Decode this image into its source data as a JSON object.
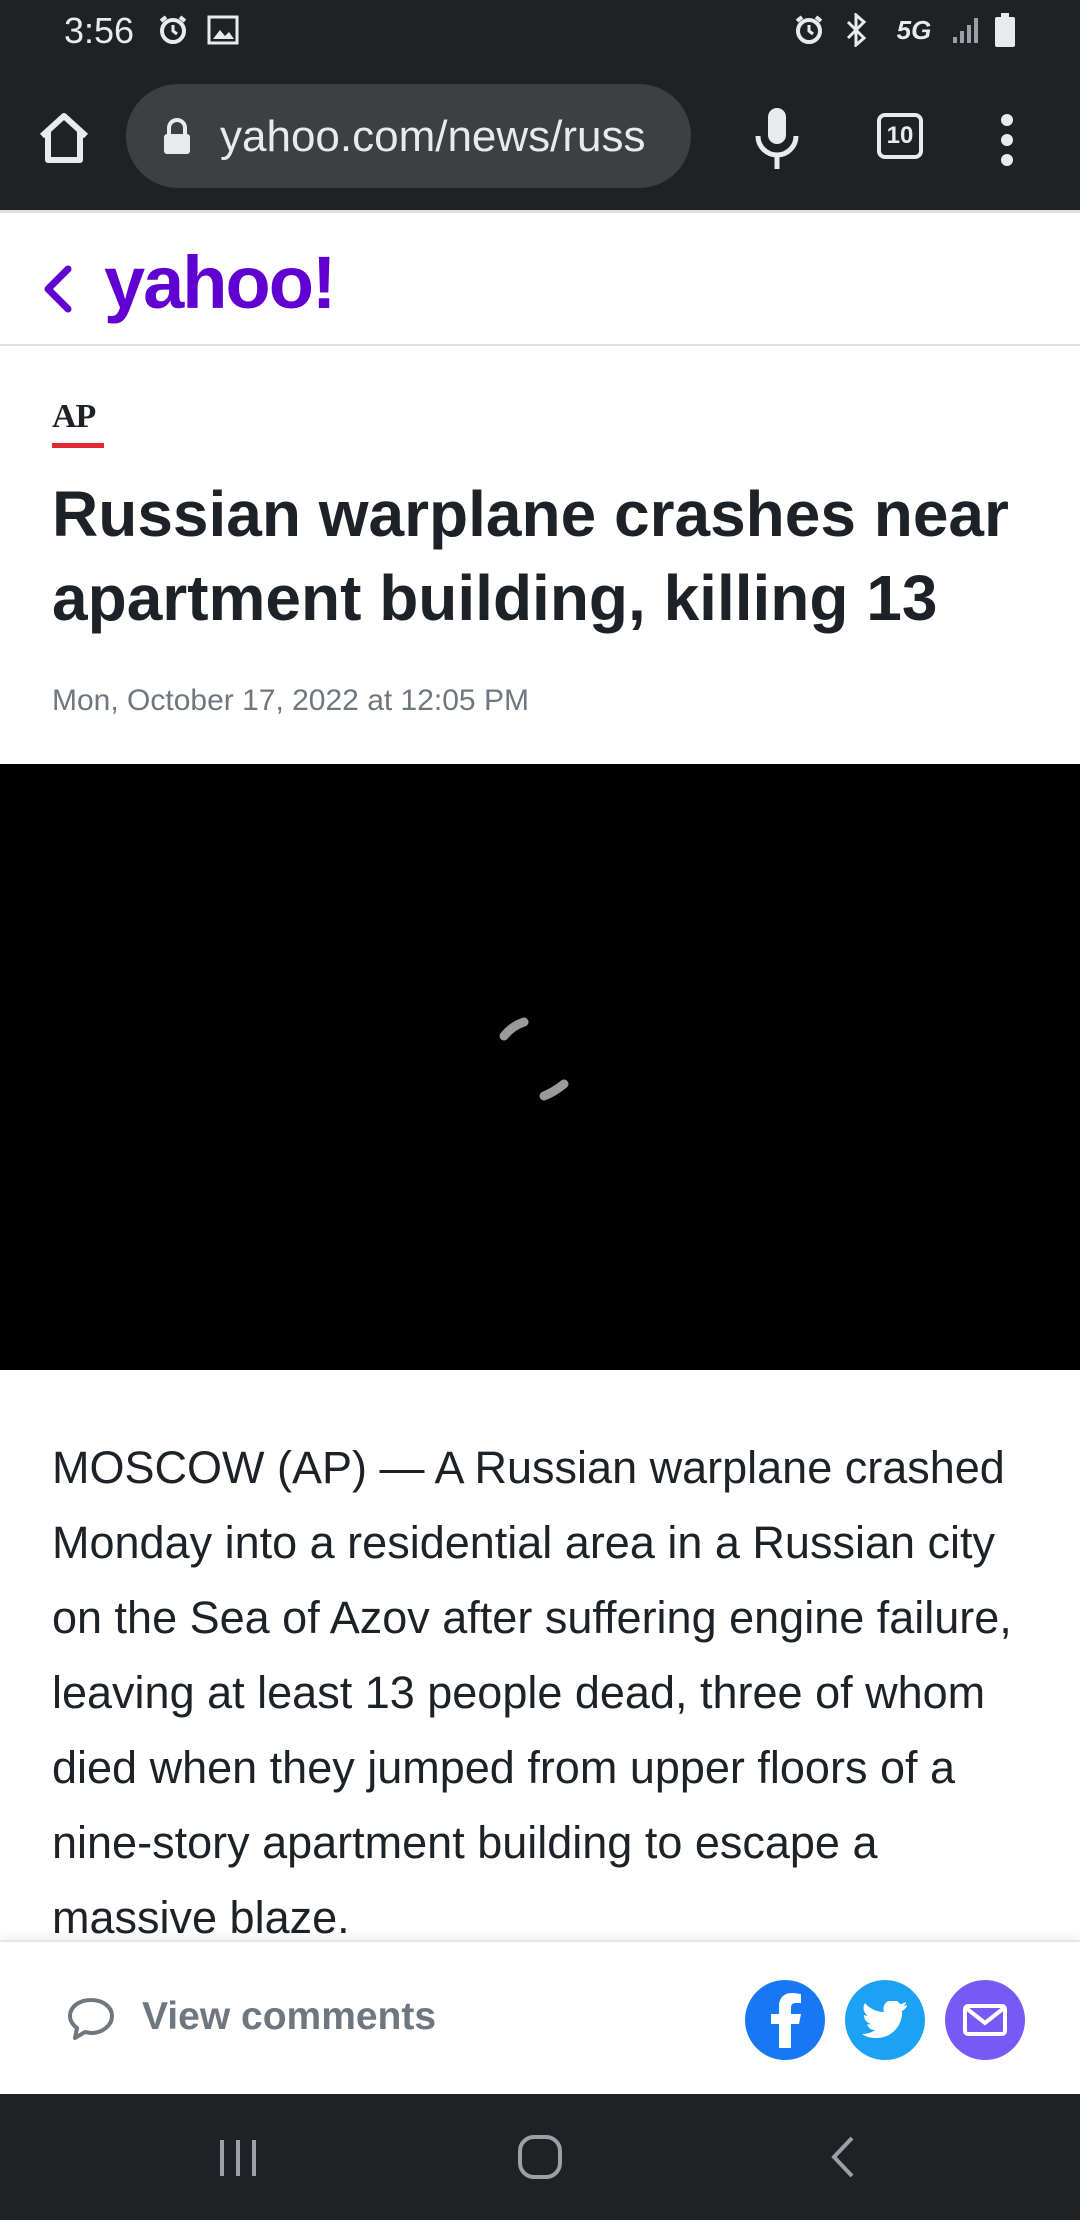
{
  "status_bar": {
    "time": "3:56",
    "network": "5G"
  },
  "browser": {
    "url": "yahoo.com/news/russ",
    "tab_count": "10"
  },
  "site": {
    "logo": "yahoo!",
    "brand_color": "#6001d2"
  },
  "article": {
    "source": "AP",
    "title": "Russian warplane crashes near apartment building, killing 13",
    "date": "Mon, October 17, 2022 at 12:05 PM",
    "body": "MOSCOW (AP) — A Russian warplane crashed Monday into a residential area in a Russian city on the Sea of Azov after suffering engine failure, leaving at least 13 people dead, three of whom died when they jumped from upper floors of a nine-story apartment building to escape a massive blaze."
  },
  "actions": {
    "comments_label": "View comments"
  }
}
